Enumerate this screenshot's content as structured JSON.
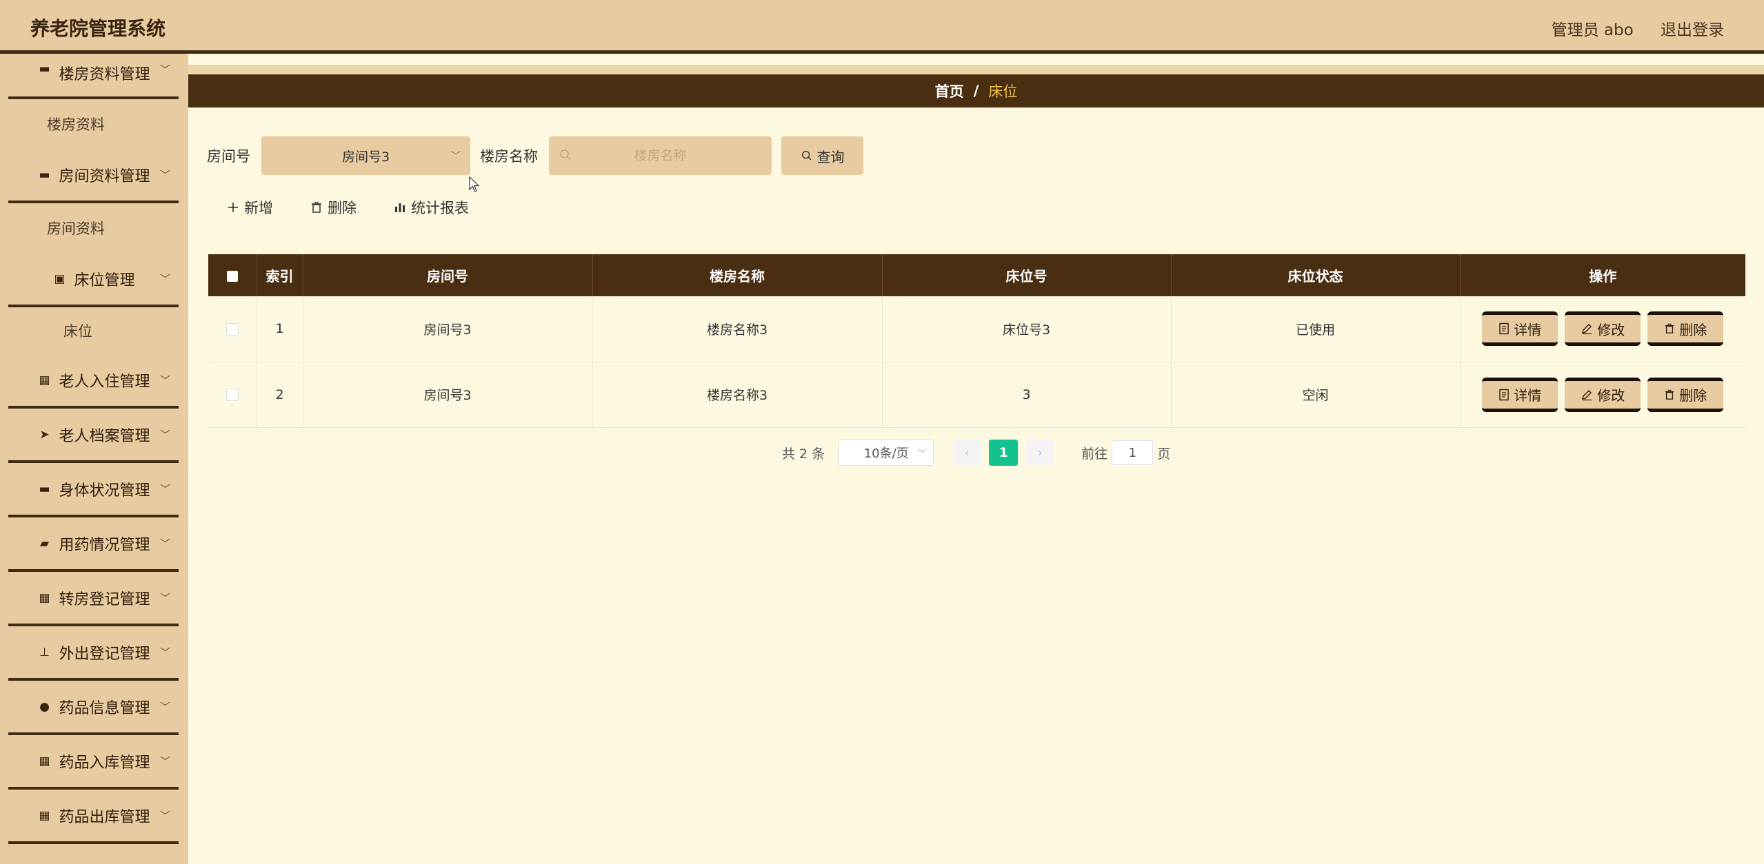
{
  "header": {
    "title": "养老院管理系统",
    "user": "管理员 abo",
    "logout": "退出登录"
  },
  "sidebar": {
    "items": [
      {
        "icon": "message-icon",
        "label": "楼房资料管理",
        "sub": "楼房资料"
      },
      {
        "icon": "calendar-icon",
        "label": "房间资料管理",
        "sub": "房间资料"
      },
      {
        "icon": "delete-doc-icon",
        "label": "床位管理",
        "sub": "床位"
      },
      {
        "icon": "grid-icon",
        "label": "老人入住管理"
      },
      {
        "icon": "send-icon",
        "label": "老人档案管理"
      },
      {
        "icon": "flag-icon",
        "label": "身体状况管理"
      },
      {
        "icon": "briefcase-icon",
        "label": "用药情况管理"
      },
      {
        "icon": "grid-icon",
        "label": "转房登记管理"
      },
      {
        "icon": "stamp-icon",
        "label": "外出登记管理"
      },
      {
        "icon": "pin-icon",
        "label": "药品信息管理"
      },
      {
        "icon": "grid-icon",
        "label": "药品入库管理"
      },
      {
        "icon": "grid-icon",
        "label": "药品出库管理"
      }
    ]
  },
  "breadcrumb": {
    "home": "首页",
    "separator": "/",
    "current": "床位"
  },
  "search": {
    "room_label": "房间号",
    "room_value": "房间号3",
    "building_label": "楼房名称",
    "building_placeholder": "楼房名称",
    "query_button": "查询"
  },
  "toolbar": {
    "add": "新增",
    "delete": "删除",
    "report": "统计报表"
  },
  "table": {
    "columns": [
      "索引",
      "房间号",
      "楼房名称",
      "床位号",
      "床位状态",
      "操作"
    ],
    "rows": [
      {
        "index": "1",
        "room": "房间号3",
        "building": "楼房名称3",
        "bed": "床位号3",
        "status": "已使用"
      },
      {
        "index": "2",
        "room": "房间号3",
        "building": "楼房名称3",
        "bed": "3",
        "status": "空闲"
      }
    ],
    "actions": {
      "detail": "详情",
      "edit": "修改",
      "delete": "删除"
    }
  },
  "pagination": {
    "total": "共 2 条",
    "page_size": "10条/页",
    "current_page": "1",
    "goto_label": "前往",
    "goto_value": "1",
    "page_suffix": "页"
  },
  "colors": {
    "header_bg": "#e8cba0",
    "dark_brown": "#4a2e12",
    "content_bg": "#fdf9e1",
    "breadcrumb_current": "#f1c24a",
    "page_active": "#13c28f"
  }
}
